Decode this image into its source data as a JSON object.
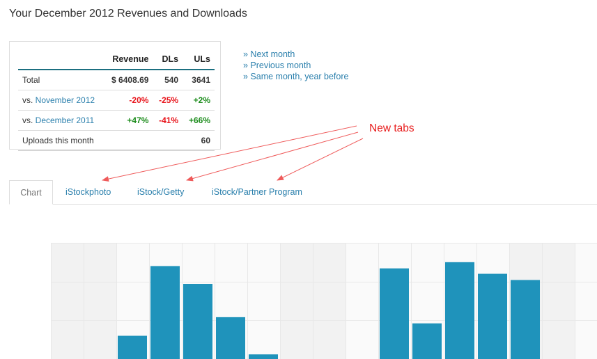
{
  "page": {
    "title": "Your December 2012 Revenues and Downloads"
  },
  "stats": {
    "headers": [
      "Revenue",
      "DLs",
      "ULs"
    ],
    "rows": [
      {
        "prefix": "Total",
        "link": "",
        "revenue": "$ 6408.69",
        "dls": "540",
        "uls": "3641",
        "style": "plain"
      },
      {
        "prefix": "vs. ",
        "link": "November 2012",
        "revenue": "-20%",
        "dls": "-25%",
        "uls": "+2%",
        "style": "compare"
      },
      {
        "prefix": "vs. ",
        "link": "December 2011",
        "revenue": "+47%",
        "dls": "-41%",
        "uls": "+66%",
        "style": "compare"
      },
      {
        "prefix": "Uploads this month",
        "link": "",
        "revenue": "",
        "dls": "",
        "uls": "60",
        "style": "plain"
      }
    ]
  },
  "nav_links": [
    "» Next month",
    "» Previous month",
    "» Same month, year before"
  ],
  "annotation": {
    "text": "New tabs",
    "color": "#e81e1e"
  },
  "tabs": [
    {
      "label": "Chart",
      "active": true
    },
    {
      "label": "iStockphoto",
      "active": false
    },
    {
      "label": "iStock/Getty",
      "active": false
    },
    {
      "label": "iStock/Partner Program",
      "active": false
    }
  ],
  "colors": {
    "bar": "#1f93bb",
    "link": "#2a7fac",
    "negative": "#e8131a",
    "positive": "#1c8c1c"
  },
  "chart_data": {
    "type": "bar",
    "categories": [],
    "values": [
      0,
      0,
      0.3,
      1.2,
      0.97,
      0.54,
      0.06,
      0,
      0,
      0,
      1.17,
      0.46,
      1.25,
      1.1,
      1.02,
      0,
      0,
      0.8
    ],
    "ylim": [
      0,
      1.5
    ],
    "grid": true,
    "weekend_shading": [
      0,
      1,
      7,
      8,
      14,
      15
    ],
    "title": "",
    "xlabel": "",
    "ylabel": ""
  }
}
